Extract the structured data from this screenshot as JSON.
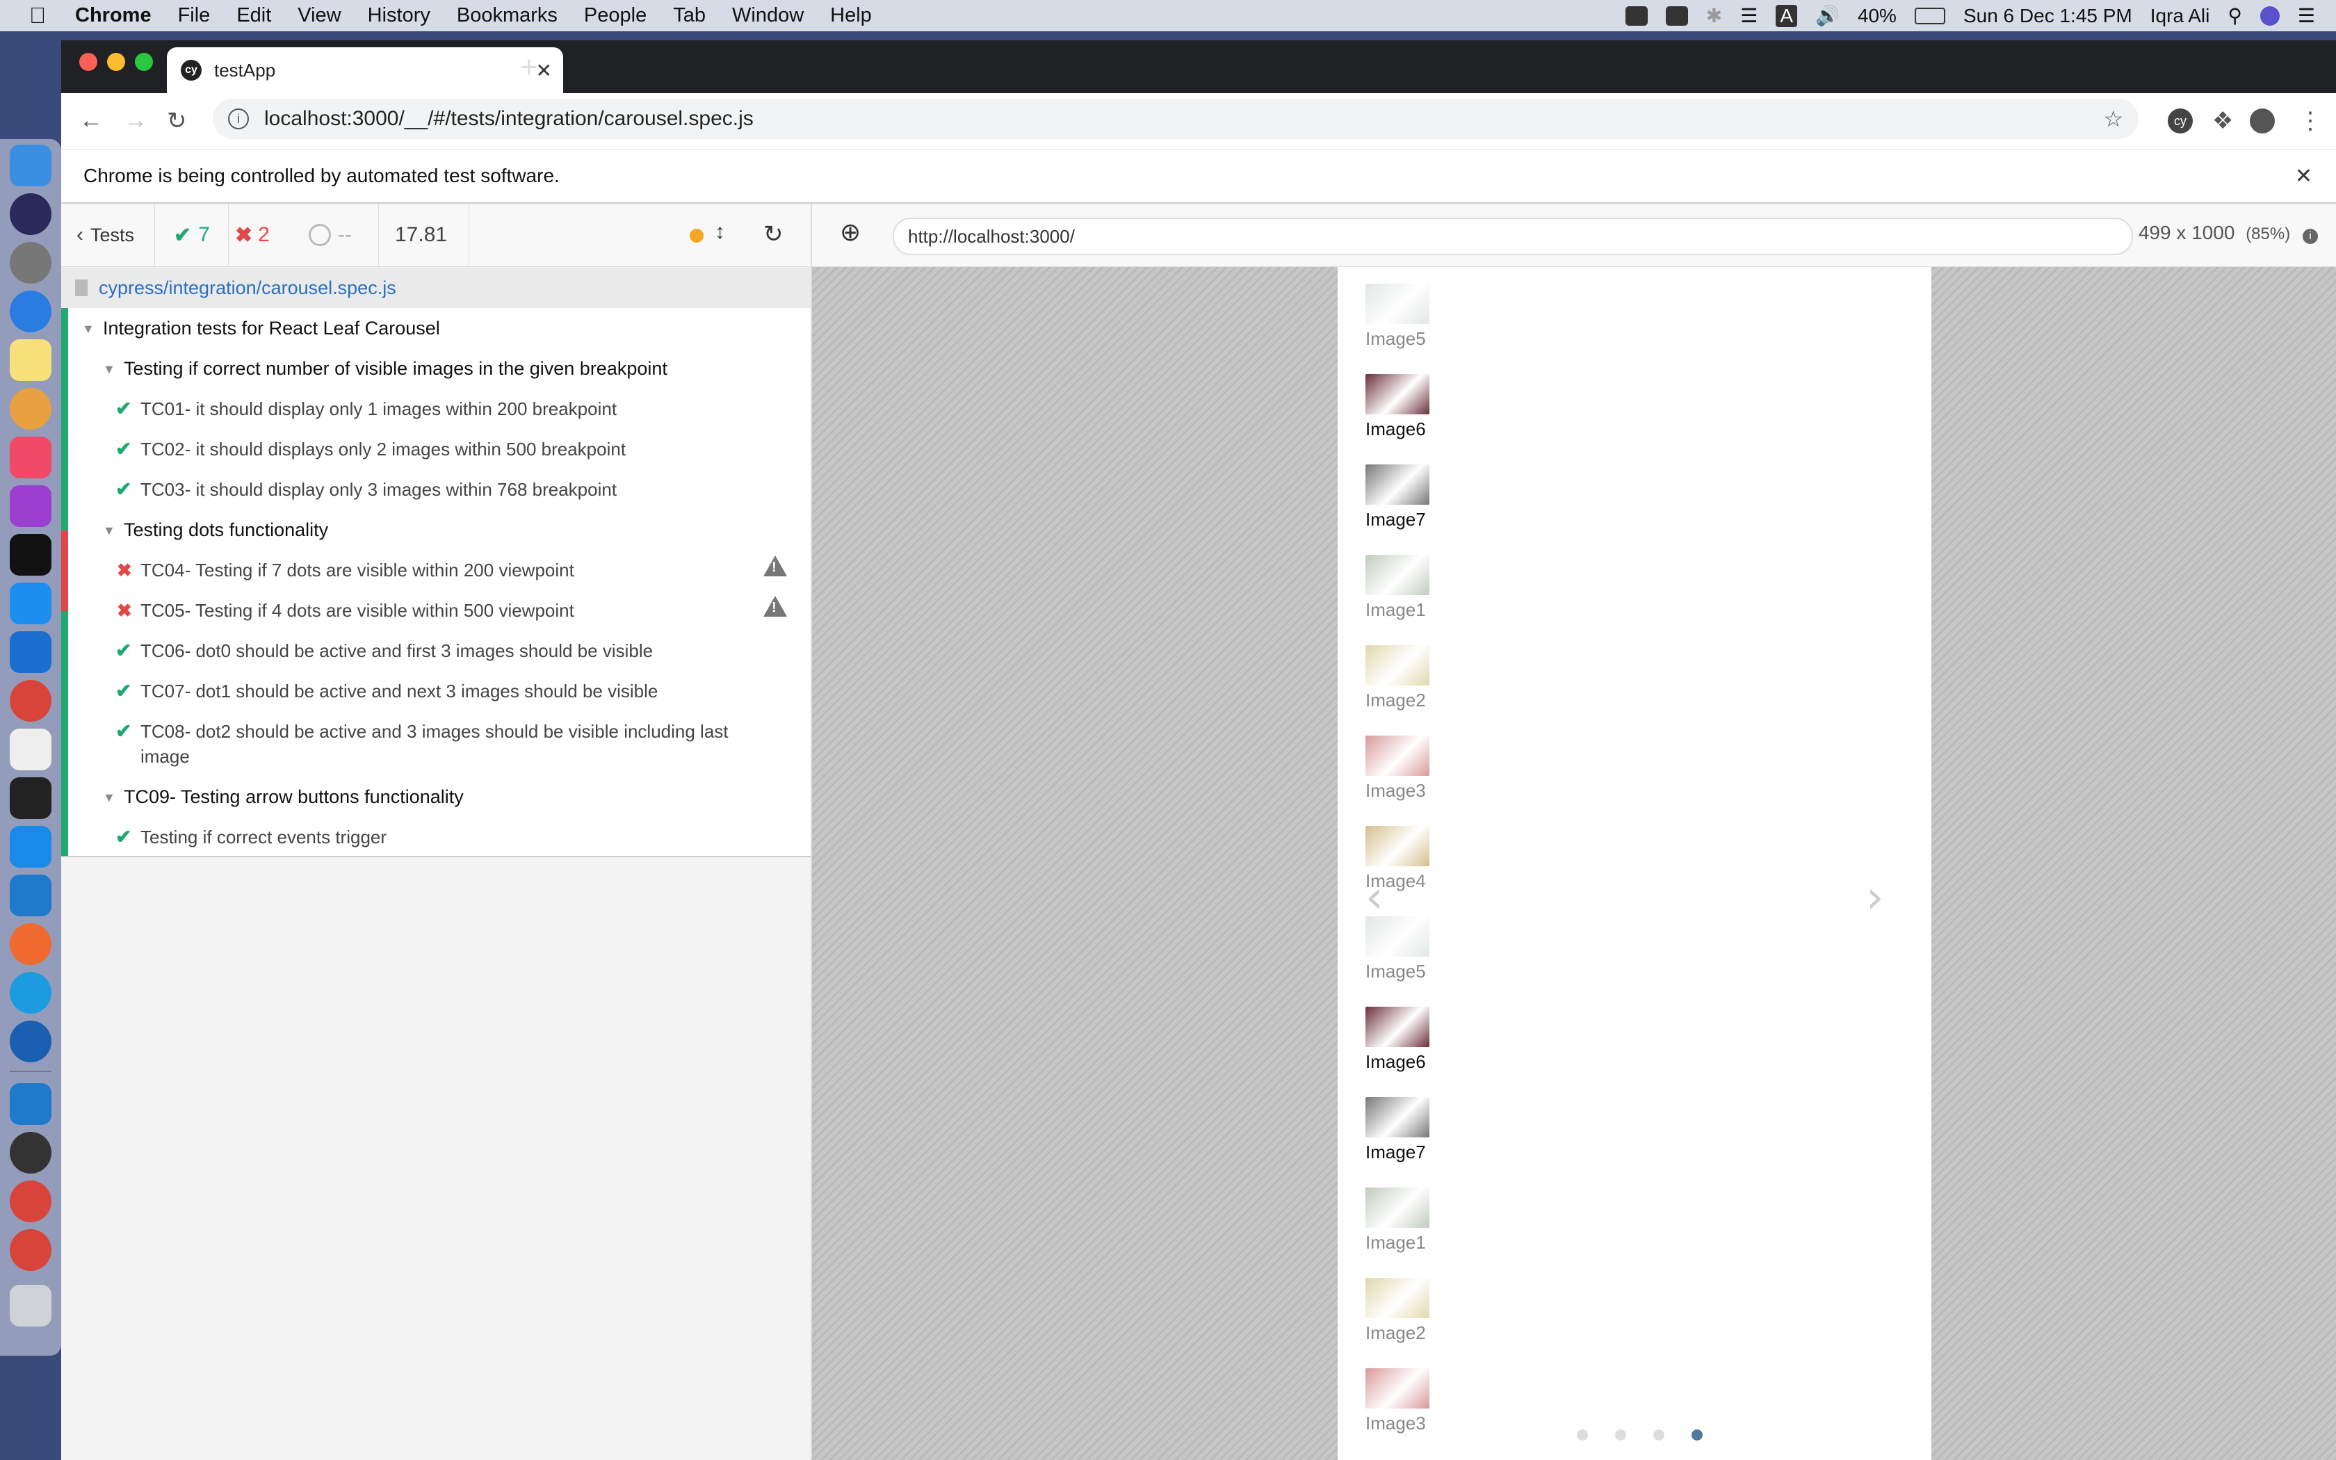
{
  "menubar": {
    "app": "Chrome",
    "items": [
      "File",
      "Edit",
      "View",
      "History",
      "Bookmarks",
      "People",
      "Tab",
      "Window",
      "Help"
    ],
    "battery": "40%",
    "datetime": "Sun 6 Dec  1:45 PM",
    "user": "Iqra Ali",
    "input_source": "A"
  },
  "browser": {
    "tab_title": "testApp",
    "tab_favicon": "cy",
    "url": "localhost:3000/__/#/tests/integration/carousel.spec.js",
    "ext_badge": "cy",
    "infobar": "Chrome is being controlled by automated test software."
  },
  "reporter": {
    "back_label": "Tests",
    "passed": "7",
    "failed": "2",
    "pending": "--",
    "duration": "17.81",
    "spec_path": "cypress/integration/carousel.spec.js",
    "root_suite": "Integration tests for React Leaf Carousel",
    "suites": [
      {
        "title": "Testing if correct number of visible images in the given breakpoint",
        "tests": [
          {
            "title": "TC01- it should display only 1 images within 200 breakpoint",
            "state": "passed"
          },
          {
            "title": "TC02- it should displays only 2 images within 500 breakpoint",
            "state": "passed"
          },
          {
            "title": "TC03- it should display only 3 images within 768 breakpoint",
            "state": "passed"
          }
        ]
      },
      {
        "title": "Testing dots functionality",
        "tests": [
          {
            "title": "TC04- Testing if 7 dots are visible within 200 viewpoint",
            "state": "failed"
          },
          {
            "title": "TC05- Testing if 4 dots are visible within 500 viewpoint",
            "state": "failed"
          },
          {
            "title": "TC06- dot0 should be active and first 3 images should be visible",
            "state": "passed"
          },
          {
            "title": "TC07- dot1 should be active and next 3 images should be visible",
            "state": "passed"
          },
          {
            "title": "TC08- dot2 should be active and 3 images should be visible including last",
            "title2": "image",
            "state": "passed"
          }
        ]
      },
      {
        "title": "TC09- Testing arrow buttons functionality",
        "tests": [
          {
            "title": "Testing if correct events trigger",
            "state": "passed"
          }
        ]
      }
    ]
  },
  "aut": {
    "url": "http://localhost:3000/",
    "viewport": "499 x 1000",
    "scale": "(85%)",
    "slides": [
      {
        "label": "Image5",
        "faded": true,
        "color": "#c9d3cf"
      },
      {
        "label": "Image6",
        "faded": false,
        "color": "#6b2e3a"
      },
      {
        "label": "Image7",
        "faded": false,
        "color": "#777777"
      },
      {
        "label": "Image1",
        "faded": true,
        "color": "#8fa08a"
      },
      {
        "label": "Image2",
        "faded": true,
        "color": "#c8b86a"
      },
      {
        "label": "Image3",
        "faded": true,
        "color": "#b84646"
      },
      {
        "label": "Image4",
        "faded": true,
        "color": "#b28a30"
      },
      {
        "label": "Image5",
        "faded": true,
        "color": "#c9d3cf"
      },
      {
        "label": "Image6",
        "faded": false,
        "color": "#6b2e3a"
      },
      {
        "label": "Image7",
        "faded": false,
        "color": "#777777"
      },
      {
        "label": "Image1",
        "faded": true,
        "color": "#8fa08a"
      },
      {
        "label": "Image2",
        "faded": true,
        "color": "#c8b86a"
      },
      {
        "label": "Image3",
        "faded": true,
        "color": "#b84646"
      }
    ],
    "dots": [
      false,
      false,
      false,
      true
    ]
  },
  "colors": {
    "pass": "#1fa971",
    "fail": "#e04848",
    "link": "#2c6fbf",
    "active_dot": "#4f7a99"
  }
}
